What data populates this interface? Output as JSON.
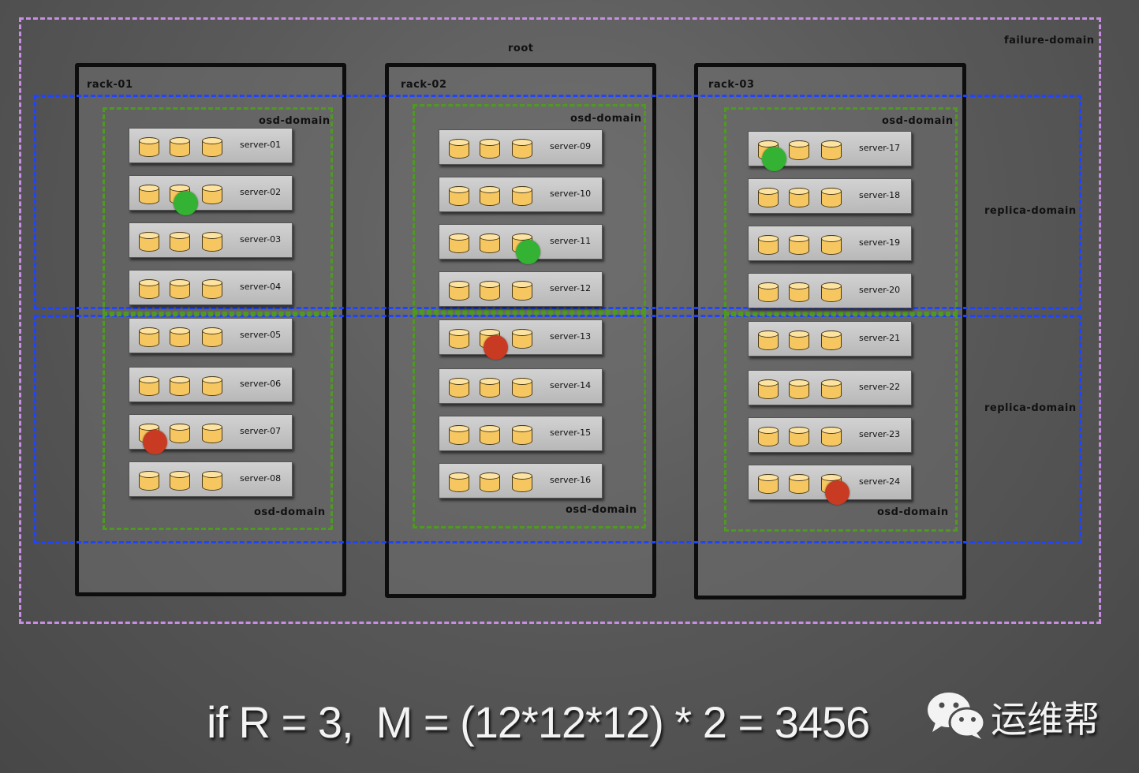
{
  "labels": {
    "root": "root",
    "failure_domain": "failure-domain",
    "replica_domain_top": "replica-domain",
    "replica_domain_bottom": "replica-domain"
  },
  "racks": [
    {
      "name": "rack-01",
      "osd_top": "osd-domain",
      "osd_bottom": "osd-domain",
      "servers": [
        "server-01",
        "server-02",
        "server-03",
        "server-04",
        "server-05",
        "server-06",
        "server-07",
        "server-08"
      ]
    },
    {
      "name": "rack-02",
      "osd_top": "osd-domain",
      "osd_bottom": "osd-domain",
      "servers": [
        "server-09",
        "server-10",
        "server-11",
        "server-12",
        "server-13",
        "server-14",
        "server-15",
        "server-16"
      ]
    },
    {
      "name": "rack-03",
      "osd_top": "osd-domain",
      "osd_bottom": "osd-domain",
      "servers": [
        "server-17",
        "server-18",
        "server-19",
        "server-20",
        "server-21",
        "server-22",
        "server-23",
        "server-24"
      ]
    }
  ],
  "replicas": [
    {
      "server": "server-02",
      "disk": 2,
      "color": "#33b233"
    },
    {
      "server": "server-11",
      "disk": 3,
      "color": "#33b233"
    },
    {
      "server": "server-17",
      "disk": 1,
      "color": "#33b233"
    },
    {
      "server": "server-07",
      "disk": 1,
      "color": "#c93a22"
    },
    {
      "server": "server-13",
      "disk": 2,
      "color": "#c93a22"
    },
    {
      "server": "server-24",
      "disk": 3,
      "color": "#c93a22"
    }
  ],
  "formula": "if R = 3,  M = (12*12*12) * 2 = 3456",
  "brand": {
    "name": "运维帮",
    "icon": "wechat-icon"
  },
  "colors": {
    "failure_domain": "#c98ee3",
    "replica_domain": "#1f44ff",
    "osd_domain": "#4e9a1f",
    "disk": "#f6c760"
  }
}
